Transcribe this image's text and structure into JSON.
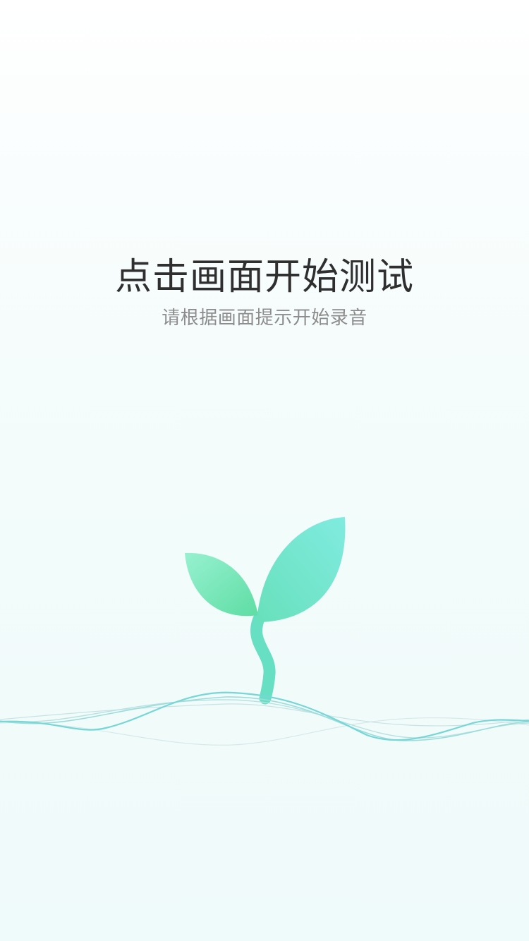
{
  "screen": {
    "title": "点击画面开始测试",
    "subtitle": "请根据画面提示开始录音"
  },
  "illustration": {
    "sprout_icon": "sprout-icon",
    "wave_icon": "sound-wave-icon"
  },
  "colors": {
    "leaf_green": "#62dfae",
    "leaf_cyan": "#7ae8de",
    "stem": "#66dfc2",
    "wave": "#77d6d6",
    "title_text": "#2f2f2f",
    "subtitle_text": "#8c8c8c"
  }
}
